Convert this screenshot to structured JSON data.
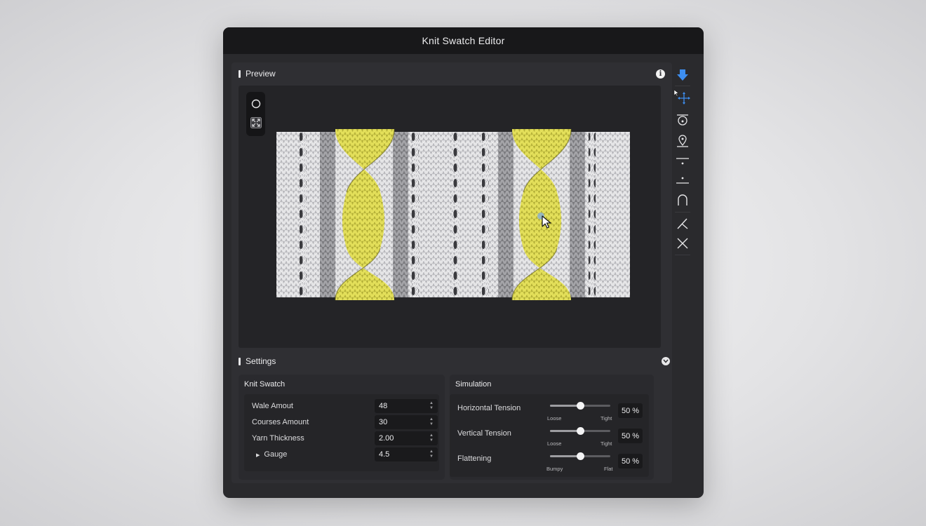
{
  "window": {
    "title": "Knit Swatch Editor"
  },
  "preview": {
    "title": "Preview",
    "info_icon": "info-icon",
    "view_tools": [
      "orbit-icon",
      "fit-view-icon"
    ]
  },
  "settings": {
    "title": "Settings",
    "knit_swatch": {
      "title": "Knit Swatch",
      "fields": [
        {
          "label": "Wale Amout",
          "value": "48"
        },
        {
          "label": "Courses Amount",
          "value": "30"
        },
        {
          "label": "Yarn Thickness",
          "value": "2.00"
        },
        {
          "label": "Gauge",
          "value": "4.5"
        }
      ]
    },
    "simulation": {
      "title": "Simulation",
      "sliders": [
        {
          "label": "Horizontal Tension",
          "min_label": "Loose",
          "max_label": "Tight",
          "value": 50,
          "display": "50 %"
        },
        {
          "label": "Vertical Tension",
          "min_label": "Loose",
          "max_label": "Tight",
          "value": 50,
          "display": "50 %"
        },
        {
          "label": "Flattening",
          "min_label": "Bumpy",
          "max_label": "Flat",
          "value": 50,
          "display": "50 %"
        }
      ]
    }
  },
  "toolbar": {
    "tools": [
      "arrow-down-icon",
      "move-icon",
      "loop-pin-icon",
      "pin-icon",
      "align-top-icon",
      "align-bottom-icon",
      "arch-icon",
      "angle-icon",
      "cross-icon"
    ]
  },
  "colors": {
    "accent": "#3d8ef0",
    "yarn_yellow": "#e4e05a",
    "yarn_white": "#e8e8ea"
  }
}
